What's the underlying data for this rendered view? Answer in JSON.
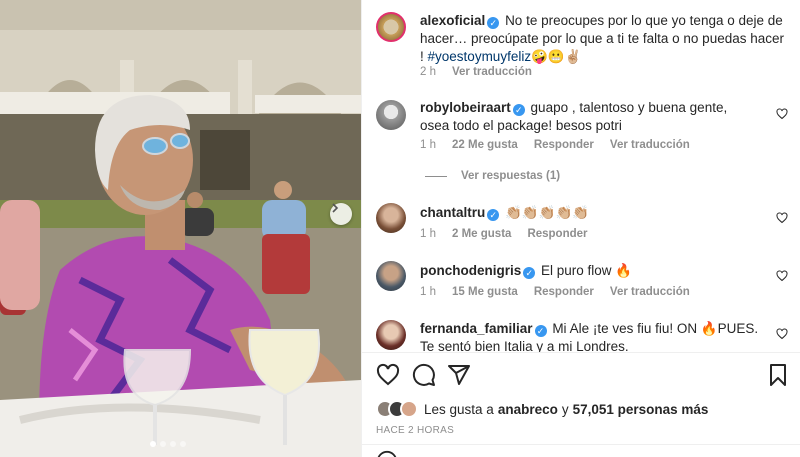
{
  "photo": {
    "next_icon": "chevron-right-icon",
    "carousel_pages": 4,
    "carousel_active": 1
  },
  "post": {
    "author": "alexoficial",
    "caption": "No te preocupes por lo que yo tenga o deje de hacer… preocúpate por lo que a ti te falta o no puedas hacer !",
    "hashtag": "#yoestoymuyfeliz",
    "emojis": "🤪😬✌🏼",
    "time": "2 h",
    "translate": "Ver traducción"
  },
  "comments": [
    {
      "user": "robylobeiraart",
      "text": "guapo , talentoso y buena gente, osea todo el package! besos potri",
      "time": "1 h",
      "likes": "22 Me gusta",
      "reply": "Responder",
      "translate": "Ver traducción"
    },
    {
      "user": "chantaltru",
      "text": "👏🏼👏🏼👏🏼👏🏼👏🏼",
      "time": "1 h",
      "likes": "2 Me gusta",
      "reply": "Responder"
    },
    {
      "user": "ponchodenigris",
      "text": "El puro flow 🔥",
      "time": "1 h",
      "likes": "15 Me gusta",
      "reply": "Responder",
      "translate": "Ver traducción"
    },
    {
      "user": "fernanda_familiar",
      "text": "Mi Ale ¡te ves fiu fiu! ON 🔥PUES. Te sentó bien Italia y a mi Londres."
    }
  ],
  "view_replies": "Ver respuestas (1)",
  "actions": {
    "like_icon": "heart-icon",
    "comment_icon": "comment-icon",
    "share_icon": "send-icon",
    "save_icon": "bookmark-icon"
  },
  "likes": {
    "prefix": "Les gusta a",
    "user": "anabreco",
    "conj": "y",
    "count": "57,051 personas más"
  },
  "posted_ago": "HACE 2 HORAS",
  "colors": {
    "verified": "#3897f0",
    "muted": "#8e8e8e",
    "hashtag": "#00376b",
    "text": "#262626"
  }
}
